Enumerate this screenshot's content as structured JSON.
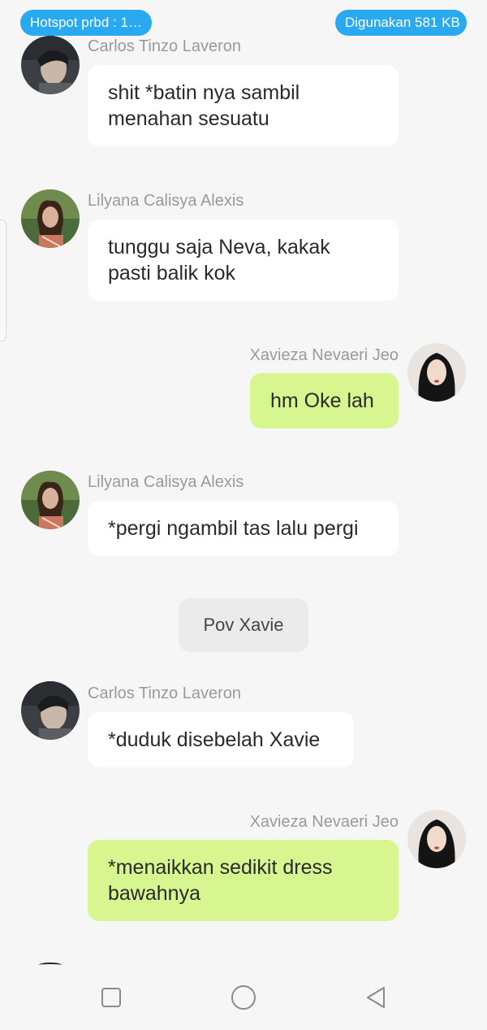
{
  "status_bar": {
    "hotspot": "Hotspot prbd : 1 ...",
    "data_used": "Digunakan 581 KB"
  },
  "messages": [
    {
      "sender": "Carlos Tinzo Laveron",
      "text": "shit *batin nya sambil\nmenahan sesuatu",
      "side": "left"
    },
    {
      "sender": "Lilyana Calisya Alexis",
      "text": "tunggu saja Neva, kakak\npasti balik kok",
      "side": "left"
    },
    {
      "sender": "Xavieza Nevaeri Jeo",
      "text": "hm Oke lah",
      "side": "right"
    },
    {
      "sender": "Lilyana Calisya Alexis",
      "text": "*pergi ngambil tas lalu pergi",
      "side": "left"
    },
    {
      "sender": "Carlos Tinzo Laveron",
      "text": "*duduk disebelah Xavie",
      "side": "left"
    },
    {
      "sender": "Xavieza Nevaeri Jeo",
      "text": "*menaikkan sedikit dress\nbawahnya",
      "side": "right"
    }
  ],
  "narration": "Pov Xavie",
  "colors": {
    "pill": "#29a9ef",
    "own_bubble": "#d7f690",
    "other_bubble": "#ffffff",
    "background": "#f6f6f6",
    "name_text": "#9a9a9a"
  },
  "nav_icons": [
    "square-icon",
    "circle-icon",
    "triangle-back-icon"
  ]
}
